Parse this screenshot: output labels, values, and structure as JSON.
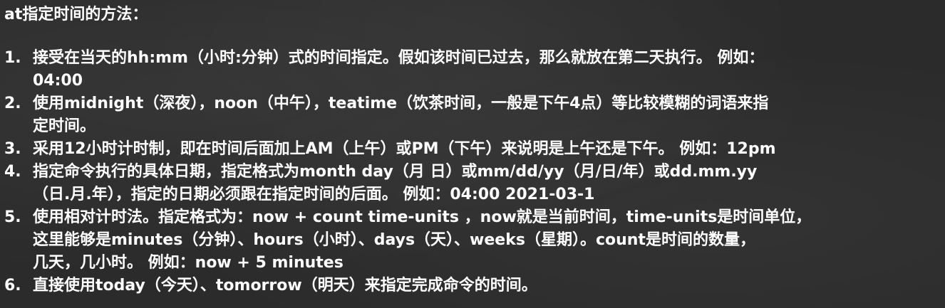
{
  "heading": "at指定时间的方法：",
  "items": [
    {
      "number": "1.",
      "lines": [
        "接受在当天的hh:mm（小时:分钟）式的时间指定。假如该时间已过去，那么就放在第二天执行。 例如：",
        "04:00"
      ]
    },
    {
      "number": "2.",
      "lines": [
        "使用midnight（深夜），noon（中午），teatime（饮茶时间，一般是下午4点）等比较模糊的词语来指",
        "定时间。"
      ]
    },
    {
      "number": "3.",
      "lines": [
        "采用12小时计时制，即在时间后面加上AM（上午）或PM（下午）来说明是上午还是下午。 例如：12pm"
      ]
    },
    {
      "number": "4.",
      "lines": [
        "指定命令执行的具体日期，指定格式为month day（月 日）或mm/dd/yy（月/日/年）或dd.mm.yy",
        "（日.月.年），指定的日期必须跟在指定时间的后面。 例如：04:00 2021-03-1"
      ]
    },
    {
      "number": "5.",
      "lines": [
        "使用相对计时法。指定格式为：now + count time-units ，now就是当前时间，time-units是时间单位，",
        "这里能够是minutes（分钟）、hours（小时）、days（天）、weeks（星期）。count是时间的数量，",
        "几天，几小时。 例如：now + 5 minutes"
      ]
    },
    {
      "number": "6.",
      "lines": [
        "直接使用today（今天）、tomorrow（明天）来指定完成命令的时间。"
      ]
    }
  ]
}
